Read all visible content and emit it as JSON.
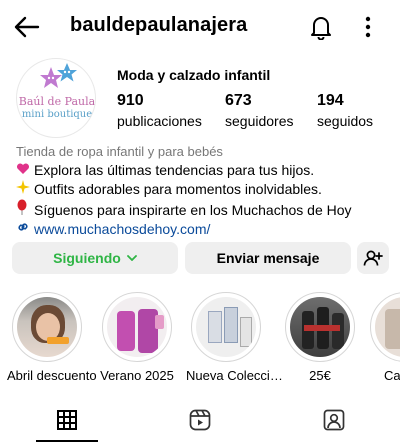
{
  "header": {
    "username": "bauldepaulanajera"
  },
  "profile": {
    "avatar_text_line1": "Baúl de Paula",
    "avatar_text_line2": "mini boutique",
    "display_name": "Moda y calzado infantil",
    "stats": [
      {
        "value": "910",
        "label": "publicaciones"
      },
      {
        "value": "673",
        "label": "seguidores"
      },
      {
        "value": "194",
        "label": "seguidos"
      }
    ]
  },
  "bio": {
    "category": "Tienda de ropa infantil y para bebés",
    "lines": [
      "Explora las últimas tendencias para tus hijos.",
      "Outfits adorables para momentos inolvidables.",
      "Síguenos para inspirarte en los Muchachos de Hoy"
    ],
    "link": "www.muchachosdehoy.com/"
  },
  "actions": {
    "following_label": "Siguiendo",
    "message_label": "Enviar mensaje"
  },
  "highlights": [
    {
      "label": "Abril descuento"
    },
    {
      "label": "Verano 2025"
    },
    {
      "label": "Nueva Colecci…"
    },
    {
      "label": "25€"
    },
    {
      "label": "Ca"
    }
  ],
  "colors": {
    "following_green": "#2fb545",
    "link_blue": "#0a4a9a",
    "button_bg": "#efefef"
  }
}
